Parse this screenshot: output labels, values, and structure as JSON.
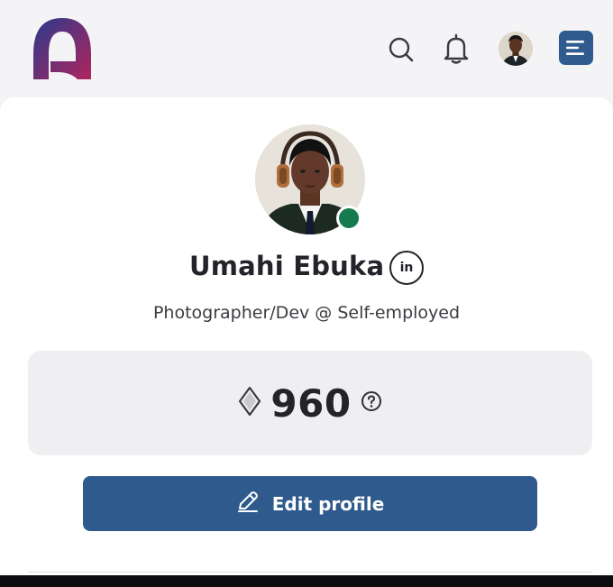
{
  "app": {
    "logo": "brand-logo-arch"
  },
  "header": {
    "icons": {
      "search": "search-icon",
      "notifications": "bell-icon",
      "menu": "menu-icon"
    }
  },
  "profile": {
    "name": "Umahi Ebuka",
    "headline": "Photographer/Dev @ Self-employed",
    "status": "online",
    "linkedin_label": "in"
  },
  "points": {
    "value": "960",
    "icon": "diamond-icon",
    "help_icon": "question-circle-icon"
  },
  "actions": {
    "edit_profile_label": "Edit profile",
    "edit_icon": "pencil-icon"
  },
  "colors": {
    "primary": "#2f5a8d",
    "online": "#157a4f",
    "logo_start": "#2a3a8c",
    "logo_end": "#b0255e"
  }
}
